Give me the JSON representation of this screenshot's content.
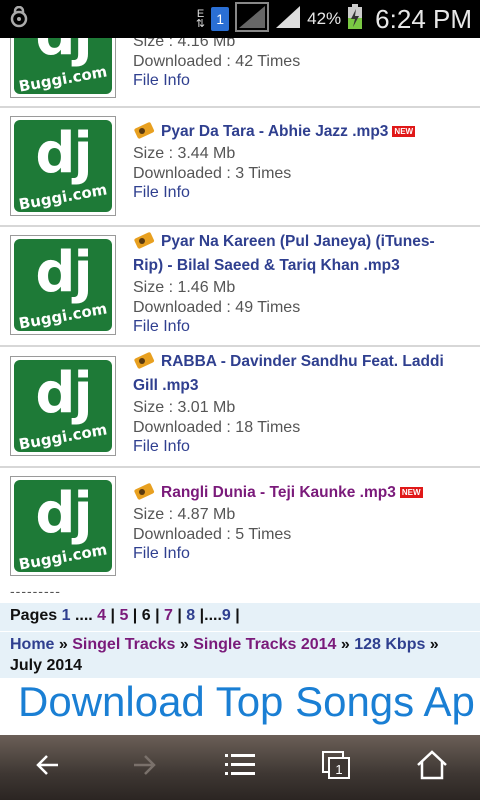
{
  "status_bar": {
    "battery_percent": "42%",
    "time": "6:24 PM",
    "sim_label": "1",
    "data_arrows": "E"
  },
  "tracks": [
    {
      "title": "",
      "size": "Size : 4.16 Mb",
      "downloads": "Downloaded : 42 Times",
      "file_info": "File Info",
      "new": false,
      "visited": false
    },
    {
      "title": "Pyar Da Tara - Abhie Jazz .mp3",
      "size": "Size : 3.44 Mb",
      "downloads": "Downloaded : 3 Times",
      "file_info": "File Info",
      "new": true,
      "visited": false
    },
    {
      "title": "Pyar Na Kareen (Pul Janeya) (iTunes-Rip) - Bilal Saeed & Tariq Khan .mp3",
      "size": "Size : 1.46 Mb",
      "downloads": "Downloaded : 49 Times",
      "file_info": "File Info",
      "new": false,
      "visited": false
    },
    {
      "title": "RABBA - Davinder Sandhu Feat. Laddi Gill .mp3",
      "size": "Size : 3.01 Mb",
      "downloads": "Downloaded : 18 Times",
      "file_info": "File Info",
      "new": false,
      "visited": false
    },
    {
      "title": "Rangli Dunia - Teji Kaunke .mp3",
      "size": "Size : 4.87 Mb",
      "downloads": "Downloaded : 5 Times",
      "file_info": "File Info",
      "new": true,
      "visited": true
    }
  ],
  "logo": {
    "big": "dj",
    "small": "Buggi.com"
  },
  "new_badge": "NEW",
  "dashes": "---------",
  "pagination": {
    "label": "Pages",
    "first": "1",
    "ellipsis1": " .... ",
    "p4": "4",
    "p5": "5",
    "current": "6",
    "p7": "7",
    "p8": "8",
    "ellipsis2": "....",
    "last": "9"
  },
  "breadcrumb": {
    "home": "Home",
    "singel_tracks": "Singel Tracks",
    "single_tracks_2014": "Single Tracks 2014",
    "kbps": "128 Kbps",
    "current": "July 2014"
  },
  "ad_text": "Download Top Songs Ap",
  "colors": {
    "link": "#2f3f8f",
    "visited": "#7a1a7a",
    "logo_green": "#1e7a37",
    "band": "#e6f1f8",
    "ad": "#1a7fd4"
  }
}
